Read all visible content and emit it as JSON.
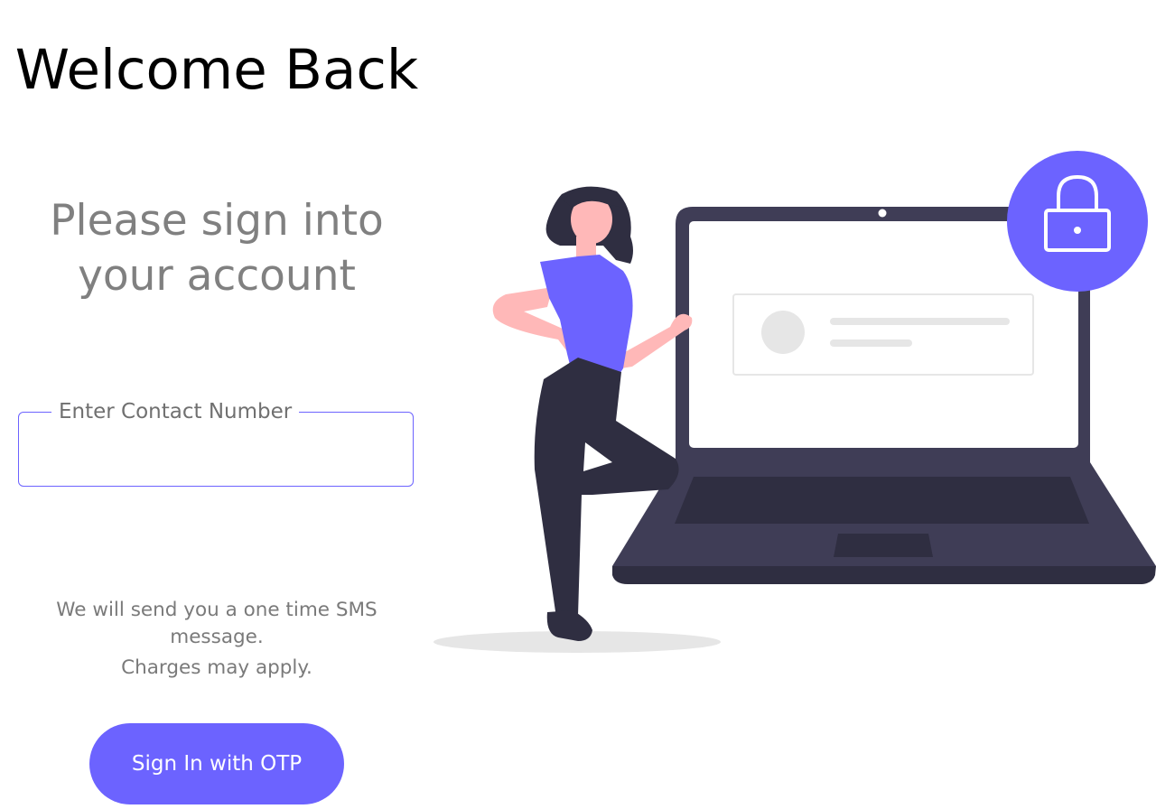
{
  "heading": {
    "welcome": "Welcome Back",
    "subtitle": "Please sign into your account"
  },
  "contact_field": {
    "label": "Enter Contact Number",
    "value": ""
  },
  "notice": {
    "line1": "We will send you a one time SMS message.",
    "line2": "Charges may apply."
  },
  "actions": {
    "otp_button": "Sign In with OTP"
  },
  "icons": {
    "lock": "lock-icon"
  },
  "colors": {
    "accent": "#6c63ff",
    "laptop": "#3f3d56",
    "laptop_dark": "#2f2e41",
    "skin": "#ffb8b8",
    "heading": "#000000",
    "muted": "#808080"
  }
}
